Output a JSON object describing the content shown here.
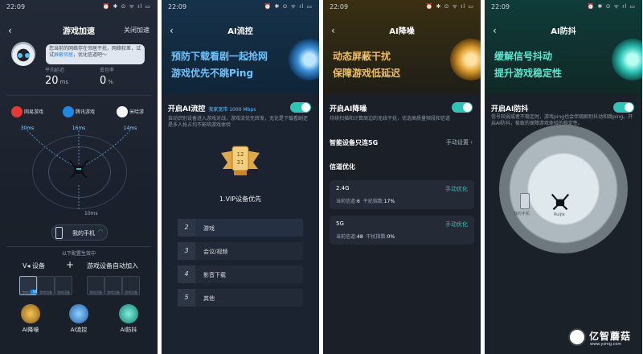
{
  "status": {
    "time": "22:09",
    "icons": "⏰ ✱ ⊙ ᯤ ıl ▭"
  },
  "panel1": {
    "title": "游戏加速",
    "action": "关闭加速",
    "bubble": {
      "pre": "您当前的网络存在邻居干扰，网络较差，试试",
      "link": "屏蔽邻居",
      "post": "，优化信道吧～"
    },
    "stats": [
      {
        "label": "平均延迟",
        "value": "20",
        "unit": "ms"
      },
      {
        "label": "丢包率",
        "value": "0",
        "unit": "%"
      }
    ],
    "games": [
      {
        "name": "网易游戏",
        "ms": "30ms",
        "color": "#e53935"
      },
      {
        "name": "腾讯游戏",
        "ms": "16ms",
        "color": "#1e88e5"
      },
      {
        "name": "米哈游",
        "ms": "14ms",
        "color": "#f5f5f5"
      }
    ],
    "router_ms": "10ms",
    "my_phone": "我的手机",
    "config_bar": "以下配置生效中",
    "device_label": "设备",
    "game_device_label": "游戏设备自动加入",
    "slot_caption": "游戏设备",
    "tag": "VIP",
    "features": [
      {
        "label": "AI降噪",
        "color": "#e0a030"
      },
      {
        "label": "AI流控",
        "color": "#4a8fe0"
      },
      {
        "label": "AI防抖",
        "color": "#2ec4b6"
      }
    ]
  },
  "panel2": {
    "title": "AI流控",
    "hero": [
      "预防下载看剧一起抢网",
      "游戏优先不跳Ping"
    ],
    "switch_label": "开启AI流控",
    "bandwidth": "我家宽带 1000 Mbps",
    "desc": "自动识别设备进入游戏对战，游戏流优先转发，无论是下载看剧还是多人抢占均不影响游戏体验",
    "badge_text": "12\n31",
    "vip_title": "1.VIP设备优先",
    "priorities": [
      {
        "num": "2",
        "label": "游戏"
      },
      {
        "num": "3",
        "label": "会议/视频"
      },
      {
        "num": "4",
        "label": "影音下载"
      },
      {
        "num": "5",
        "label": "其他"
      }
    ]
  },
  "panel3": {
    "title": "AI降噪",
    "hero": [
      "动态屏蔽干扰",
      "保障游戏低延迟"
    ],
    "switch_label": "开启AI降噪",
    "desc": "持续扫描和计算周边的无线干扰，优选高质量频段和信道",
    "smart_5g": "智能设备只连5G",
    "manual_setting": "手动设置",
    "channel_title": "信道优化",
    "channels": [
      {
        "band": "2.4G",
        "action": "手动优化",
        "current_label": "当前信道:",
        "current": "6",
        "index_label": "干扰指数:",
        "index": "17%"
      },
      {
        "band": "5G",
        "action": "手动优化",
        "current_label": "当前信道:",
        "current": "48",
        "index_label": "干扰指数:",
        "index": "0%"
      }
    ]
  },
  "panel4": {
    "title": "AI防抖",
    "hero": [
      "缓解信号抖动",
      "提升游戏稳定性"
    ],
    "switch_label": "开启AI防抖",
    "desc": "信号较弱或者不稳定时，游戏ping也会伴随剧烈抖动和跳ping。开启AI防抖，极致的保障游戏体验的稳定性。",
    "phone_label": "我的手机",
    "router_label": "Ruijie"
  },
  "watermark": {
    "name": "亿智蘑菇",
    "url": "www.yzmg.com"
  }
}
